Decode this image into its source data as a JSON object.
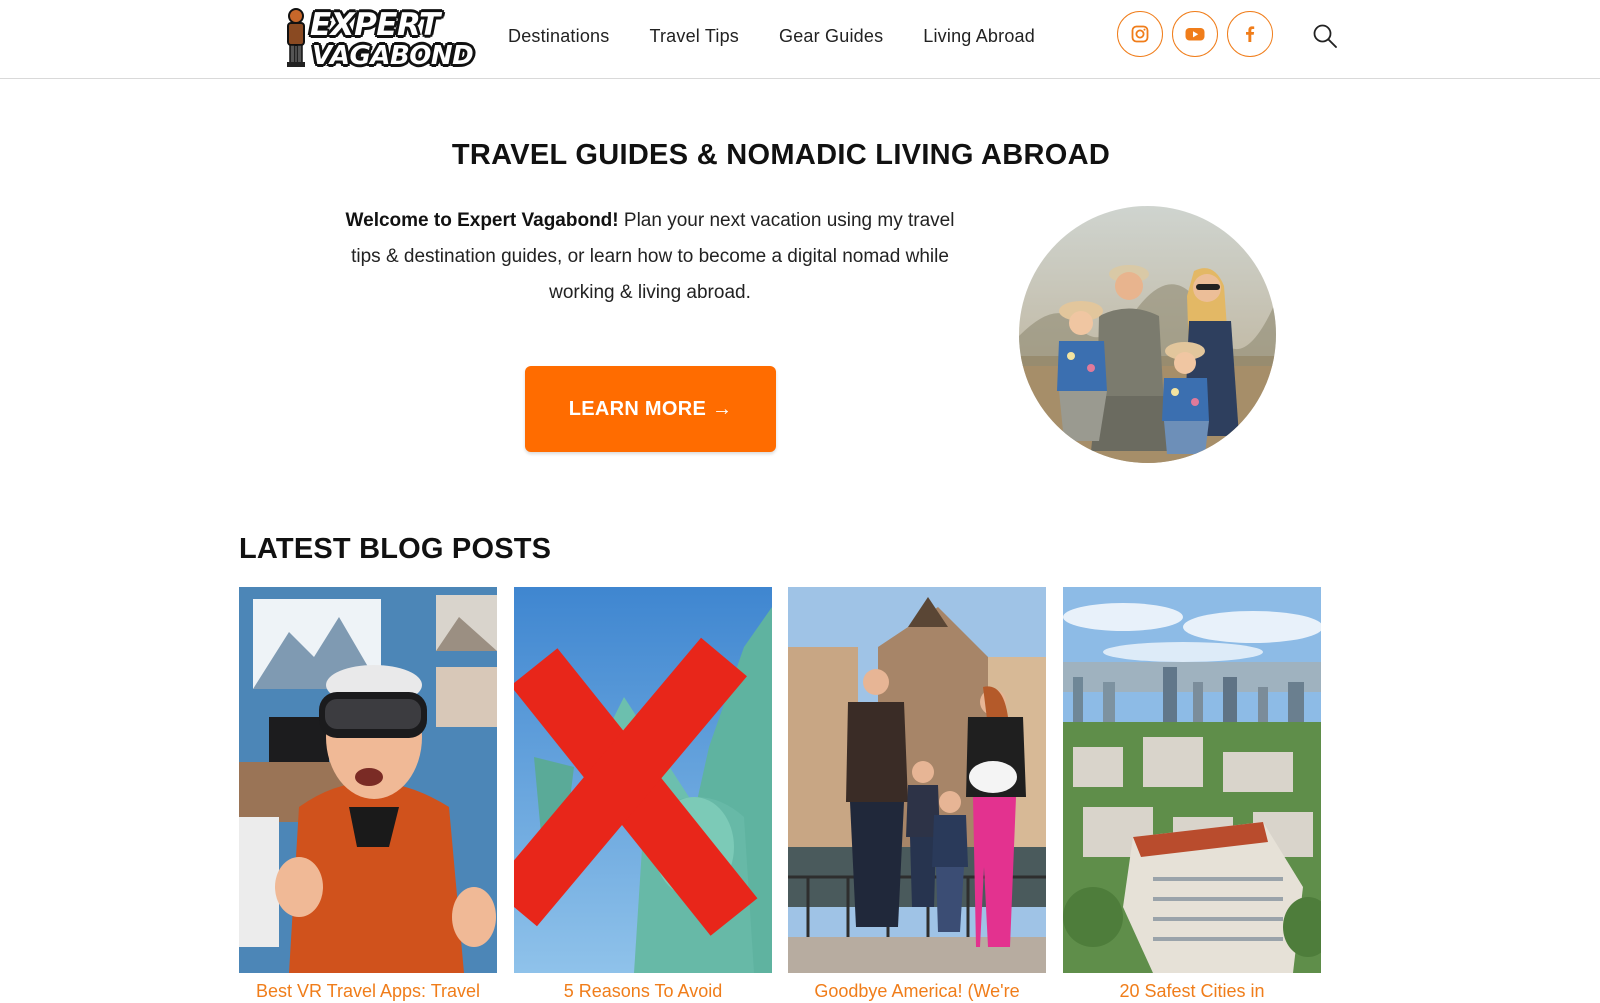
{
  "header": {
    "logo": {
      "line1": "EXPERT",
      "line2": "VAGABOND"
    },
    "nav": [
      "Destinations",
      "Travel Tips",
      "Gear Guides",
      "Living Abroad"
    ],
    "social": [
      "instagram-icon",
      "youtube-icon",
      "facebook-icon"
    ],
    "search_icon": "search-icon"
  },
  "hero": {
    "title": "TRAVEL GUIDES & NOMADIC LIVING ABROAD",
    "intro_bold": "Welcome to Expert Vagabond!",
    "intro_rest": " Plan your next vacation using my travel tips & destination guides, or learn how to become a digital nomad while working & living abroad.",
    "cta_label": "LEARN MORE →"
  },
  "blog": {
    "title": "LATEST BLOG POSTS",
    "posts": [
      {
        "title": "Best VR Travel Apps: Travel"
      },
      {
        "title": "5 Reasons To Avoid"
      },
      {
        "title": "Goodbye America! (We're"
      },
      {
        "title": "20 Safest Cities in"
      }
    ]
  },
  "colors": {
    "accent": "#f07d1a",
    "cta": "#ff6c00",
    "text": "#111111"
  }
}
